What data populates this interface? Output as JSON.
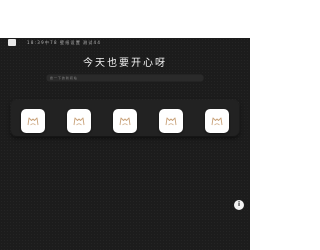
{
  "topbar": {
    "item1": "1 8 : 3 9 中 7 8",
    "item2": "壁 纸 设 置",
    "item3": "测 试 4 4"
  },
  "title": "今天也要开心呀",
  "search": {
    "placeholder": "搜 一 下 的 新 闻 站"
  },
  "shortcuts": [
    {
      "icon": "cat-logo-icon"
    },
    {
      "icon": "cat-logo-icon"
    },
    {
      "icon": "cat-logo-icon"
    },
    {
      "icon": "cat-logo-icon"
    },
    {
      "icon": "cat-logo-icon"
    }
  ],
  "fab": {
    "icon": "info-icon",
    "label": "i"
  },
  "colors": {
    "background": "#1c1c1c",
    "tile": "#ffffff",
    "icon_accent": "#c9a27a"
  }
}
